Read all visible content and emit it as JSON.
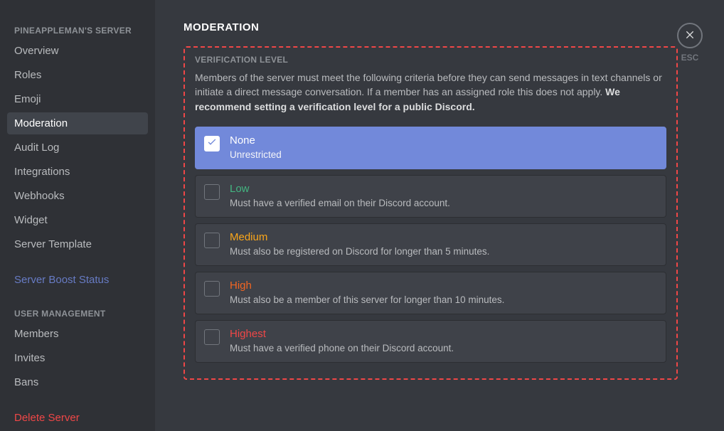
{
  "sidebar": {
    "header1": "PINEAPPLEMAN'S SERVER",
    "items1": [
      "Overview",
      "Roles",
      "Emoji",
      "Moderation",
      "Audit Log",
      "Integrations",
      "Webhooks",
      "Widget",
      "Server Template"
    ],
    "active1_index": 3,
    "boost": "Server Boost Status",
    "header2": "USER MANAGEMENT",
    "items2": [
      "Members",
      "Invites",
      "Bans"
    ],
    "delete": "Delete Server"
  },
  "page": {
    "title": "MODERATION",
    "close_label": "ESC"
  },
  "verification": {
    "section_title": "VERIFICATION LEVEL",
    "desc_plain": "Members of the server must meet the following criteria before they can send messages in text channels or initiate a direct message conversation. If a member has an assigned role this does not apply. ",
    "desc_bold": "We recommend setting a verification level for a public Discord.",
    "selected_index": 0,
    "options": [
      {
        "title": "None",
        "sub": "Unrestricted",
        "color": "none"
      },
      {
        "title": "Low",
        "sub": "Must have a verified email on their Discord account.",
        "color": "low"
      },
      {
        "title": "Medium",
        "sub": "Must also be registered on Discord for longer than 5 minutes.",
        "color": "medium"
      },
      {
        "title": "High",
        "sub": "Must also be a member of this server for longer than 10 minutes.",
        "color": "high"
      },
      {
        "title": "Highest",
        "sub": "Must have a verified phone on their Discord account.",
        "color": "highest"
      }
    ]
  }
}
